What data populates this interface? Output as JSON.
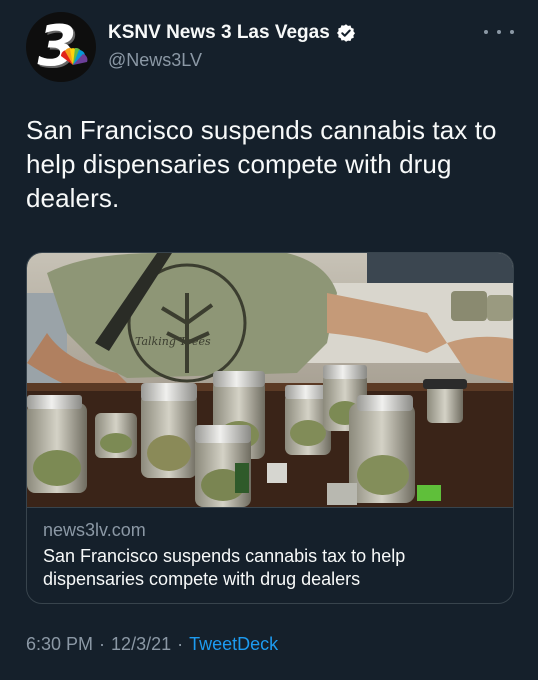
{
  "author": {
    "display_name": "KSNV News 3 Las Vegas",
    "handle": "@News3LV",
    "avatar_numeral": "3",
    "verified_icon": "verified-badge-icon"
  },
  "tweet": {
    "text": "San Francisco suspends cannabis tax to help dispensaries compete with drug dealers."
  },
  "card": {
    "image_alt": "Cannabis jars on a dispensary counter",
    "shirt_text": "Talking Trees",
    "domain": "news3lv.com",
    "title": "San Francisco suspends cannabis tax to help dispensaries compete with drug dealers"
  },
  "footer": {
    "time": "6:30 PM",
    "separator": "·",
    "date": "12/3/21",
    "source": "TweetDeck"
  },
  "colors": {
    "background": "#15202b",
    "text": "#f7f9f9",
    "secondary": "#8b98a5",
    "link": "#1d9bf0",
    "border": "#38444d"
  }
}
